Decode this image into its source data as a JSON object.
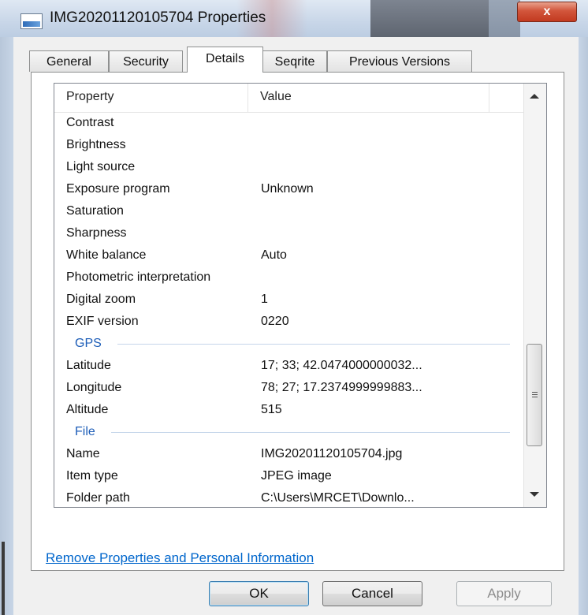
{
  "window": {
    "title": "IMG20201120105704 Properties",
    "close_glyph": "x"
  },
  "tabs": [
    {
      "label": "General"
    },
    {
      "label": "Security"
    },
    {
      "label": "Details"
    },
    {
      "label": "Seqrite"
    },
    {
      "label": "Previous Versions"
    }
  ],
  "active_tab": "Details",
  "list": {
    "columns": {
      "property": "Property",
      "value": "Value"
    },
    "rows": [
      {
        "p": "Contrast",
        "v": ""
      },
      {
        "p": "Brightness",
        "v": ""
      },
      {
        "p": "Light source",
        "v": ""
      },
      {
        "p": "Exposure program",
        "v": "Unknown"
      },
      {
        "p": "Saturation",
        "v": ""
      },
      {
        "p": "Sharpness",
        "v": ""
      },
      {
        "p": "White balance",
        "v": "Auto"
      },
      {
        "p": "Photometric interpretation",
        "v": ""
      },
      {
        "p": "Digital zoom",
        "v": "1"
      },
      {
        "p": "EXIF version",
        "v": "0220"
      }
    ],
    "gps_group": "GPS",
    "gps_rows": [
      {
        "p": "Latitude",
        "v": "17; 33; 42.0474000000032..."
      },
      {
        "p": "Longitude",
        "v": "78; 27; 17.2374999999883..."
      },
      {
        "p": "Altitude",
        "v": "515"
      }
    ],
    "file_group": "File",
    "file_rows": [
      {
        "p": "Name",
        "v": "IMG20201120105704.jpg"
      },
      {
        "p": "Item type",
        "v": "JPEG image"
      },
      {
        "p": "Folder path",
        "v": "C:\\Users\\MRCET\\Downlo..."
      }
    ]
  },
  "remove_link": "Remove Properties and Personal Information",
  "buttons": {
    "ok": "OK",
    "cancel": "Cancel",
    "apply": "Apply"
  },
  "icons": {
    "window_icon": "image-file-icon",
    "close": "close-icon",
    "scroll_up": "chevron-up-icon",
    "scroll_down": "chevron-down-icon"
  },
  "colors": {
    "link": "#0066cc",
    "group_header": "#1e5eb8",
    "close_button": "#c23a20"
  }
}
